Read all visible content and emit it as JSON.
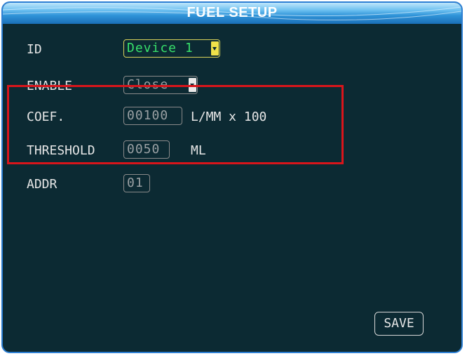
{
  "window": {
    "title": "FUEL SETUP"
  },
  "form": {
    "id": {
      "label": "ID",
      "value": "Device 1"
    },
    "enable": {
      "label": "ENABLE",
      "value": "Close"
    },
    "coef": {
      "label": "COEF.",
      "value": "00100",
      "unit": "L/MM x 100"
    },
    "threshold": {
      "label": "THRESHOLD",
      "value": "0050",
      "unit": "ML"
    },
    "addr": {
      "label": "ADDR",
      "value": "01"
    }
  },
  "buttons": {
    "save_label": "SAVE"
  },
  "colors": {
    "accent_border": "#2d7fd3",
    "highlight": "#d9151b",
    "active_text": "#38e06a",
    "background": "#0c2a33"
  }
}
